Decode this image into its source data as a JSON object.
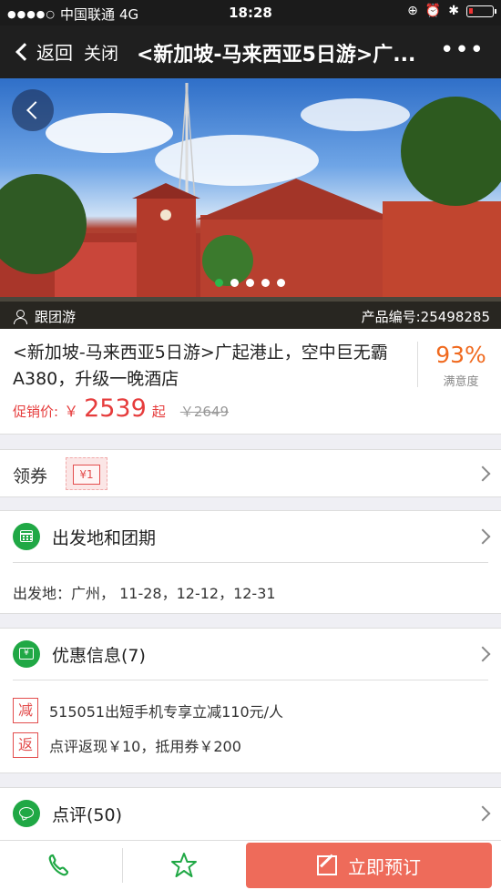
{
  "status_bar": {
    "carrier": "中国联通",
    "network": "4G",
    "time": "18:28"
  },
  "nav": {
    "back_label": "返回",
    "close_label": "关闭",
    "title": "<新加坡-马来西亚5日游>广...",
    "more_label": "•••"
  },
  "hero": {
    "tour_type": "跟团游",
    "product_code": "产品编号:25498285",
    "slide_count": 5,
    "active_slide": 1
  },
  "product": {
    "title": "<新加坡-马来西亚5日游>广起港止，空中巨无霸A380，升级一晚酒店",
    "price_label": "促销价:",
    "currency": "￥",
    "price": "2539",
    "price_suffix": "起",
    "original_price": "￥2649",
    "satisfaction": "93%",
    "satisfaction_label": "满意度"
  },
  "coupon": {
    "label": "领券",
    "chip": "¥1"
  },
  "departure": {
    "title": "出发地和团期",
    "detail": "出发地：广州，  11-28，12-12，12-31"
  },
  "promotions": {
    "title": "优惠信息(7)",
    "items": [
      {
        "tag": "减",
        "text": "515051出短手机专享立减110元/人"
      },
      {
        "tag": "返",
        "text": "点评返现￥10，抵用券￥200"
      }
    ]
  },
  "review": {
    "title": "点评(50)"
  },
  "bottom_bar": {
    "book_label": "立即预订"
  },
  "colors": {
    "accent_green": "#20a845",
    "price_red": "#e63c3c",
    "satisfaction_orange": "#f06a1f",
    "book_button": "#ee6b5a"
  },
  "icons": {
    "back": "chevron-left-icon",
    "more": "more-dots-icon",
    "user": "user-icon",
    "calendar": "calendar-icon",
    "ticket": "ticket-icon",
    "chat": "chat-bubble-icon",
    "phone": "phone-icon",
    "star": "star-icon",
    "edit": "edit-icon"
  }
}
